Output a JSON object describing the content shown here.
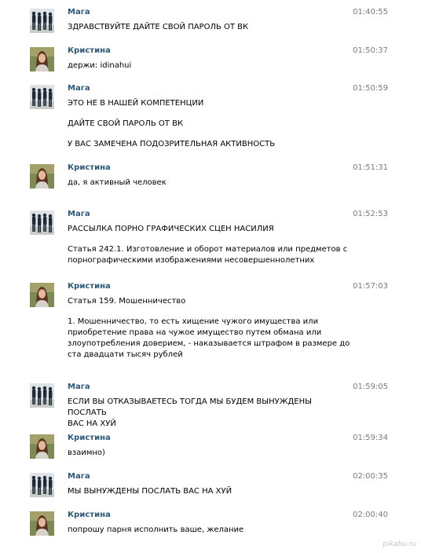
{
  "messages": [
    {
      "author": "Мага",
      "avatar": "maga",
      "time": "01:40:55",
      "paragraphs": [
        "ЗДРАВСТВУЙТЕ ДАЙТЕ СВОЙ ПАРОЛЬ ОТ ВК"
      ]
    },
    {
      "author": "Кристина",
      "avatar": "kristina",
      "time": "01:50:37",
      "paragraphs": [
        "держи: idinahui"
      ]
    },
    {
      "author": "Мага",
      "avatar": "maga",
      "time": "01:50:59",
      "paragraphs": [
        "ЭТО НЕ В НАШЕЙ КОМПЕТЕНЦИИ",
        "ДАЙТЕ СВОЙ ПАРОЛЬ ОТ ВК",
        "У ВАС ЗАМЕЧЕНА ПОДОЗРИТЕЛЬНАЯ АКТИВНОСТЬ"
      ]
    },
    {
      "author": "Кристина",
      "avatar": "kristina",
      "time": "01:51:31",
      "paragraphs": [
        "да, я активный человек"
      ]
    },
    {
      "author": "Мага",
      "avatar": "maga",
      "time": "01:52:53",
      "paragraphs": [
        "РАССЫЛКА ПОРНО ГРАФИЧЕСКИХ СЦЕН НАСИЛИЯ",
        "Статья 242.1. Изготовление и оборот материалов или предметов с\nпорнографическими изображениями несовершеннолетних"
      ]
    },
    {
      "author": "Кристина",
      "avatar": "kristina",
      "time": "01:57:03",
      "paragraphs": [
        "Статья 159. Мошенничество",
        "1. Мошенничество, то есть хищение чужого имущества или\nприобретение права на чужое имущество путем обмана или\nзлоупотребления доверием, - наказывается штрафом в размере до\nста двадцати тысяч рублей"
      ]
    },
    {
      "author": "Мага",
      "avatar": "maga",
      "time": "01:59:05",
      "paragraphs": [
        "ЕСЛИ ВЫ ОТКАЗЫВАЕТЕСЬ ТОГДА МЫ БУДЕМ ВЫНУЖДЕНЫ ПОСЛАТЬ\nВАС НА ХУЙ"
      ]
    },
    {
      "author": "Кристина",
      "avatar": "kristina",
      "time": "01:59:34",
      "paragraphs": [
        "взаимно)"
      ]
    },
    {
      "author": "Мага",
      "avatar": "maga",
      "time": "02:00:35",
      "paragraphs": [
        "МЫ ВЫНУЖДЕНЫ ПОСЛАТЬ ВАС НА ХУЙ"
      ]
    },
    {
      "author": "Кристина",
      "avatar": "kristina",
      "time": "02:00:40",
      "paragraphs": [
        "попрошу парня исполнить ваше, желание"
      ]
    }
  ],
  "watermark": "pikabu.ru"
}
